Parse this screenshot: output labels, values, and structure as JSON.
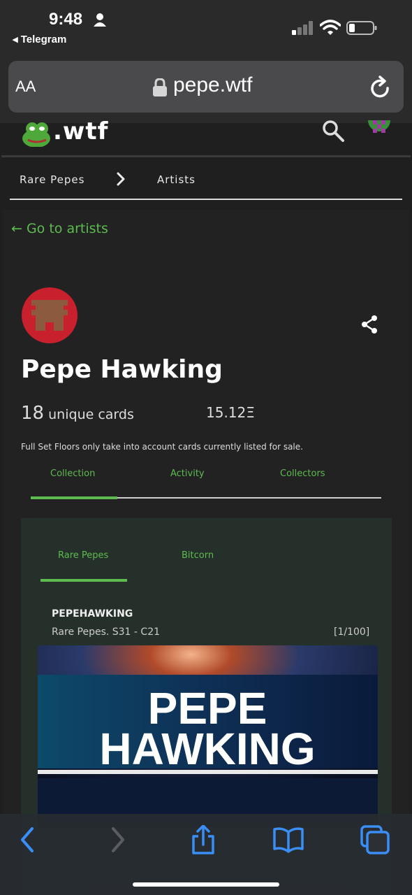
{
  "status_bar": {
    "time": "9:48",
    "back_app": "◂ Telegram"
  },
  "browser": {
    "text_size_label": "AA",
    "url": "pepe.wtf"
  },
  "site": {
    "logo_text": ".wtf"
  },
  "breadcrumb": {
    "item1": "Rare Pepes",
    "item2": "Artists"
  },
  "back_link": "← Go to artists",
  "artist": {
    "name": "Pepe Hawking",
    "unique_cards_count": "18",
    "unique_cards_label": "unique cards",
    "floor": "15.12Ξ",
    "note": "Full Set Floors only take into account cards currently listed for sale."
  },
  "tabs": {
    "collection": "Collection",
    "activity": "Activity",
    "collectors": "Collectors",
    "active": "Collection"
  },
  "sub_tabs": {
    "rare_pepes": "Rare Pepes",
    "bitcorn": "Bitcorn",
    "active": "Rare Pepes"
  },
  "card": {
    "title": "PEPEHAWKING",
    "subtitle": "Rare Pepes. S31 - C21",
    "edition": "[1/100]",
    "image_text_line1": "PEPE",
    "image_text_line2": "HAWKING"
  },
  "colors": {
    "accent": "#5dbb4f",
    "background": "#1f1f20",
    "ios_blue": "#3a8ef6"
  },
  "icons": [
    "person-icon",
    "signal-icon",
    "wifi-icon",
    "battery-icon",
    "lock-icon",
    "reload-icon",
    "frog-logo-icon",
    "search-icon",
    "user-avatar-icon",
    "chevron-right-icon",
    "share-icon",
    "back-arrow-icon",
    "forward-arrow-icon",
    "share-sheet-icon",
    "bookmarks-icon",
    "tabs-icon"
  ]
}
